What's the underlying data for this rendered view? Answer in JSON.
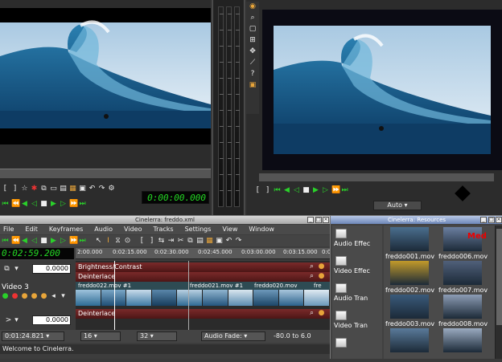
{
  "viewer": {
    "timecode": "0:00:00.000",
    "tool_icons": [
      "bracket-in-icon",
      "bracket-out-icon",
      "label-icon",
      "label-red-icon",
      "copy-icon",
      "splice-icon",
      "overwrite-icon",
      "clip-icon",
      "to-clip-icon",
      "undo-icon",
      "redo-icon",
      "settings-icon"
    ],
    "transport_icons": [
      "rewind-start-icon",
      "fast-reverse-icon",
      "frame-back-icon",
      "reverse-play-icon",
      "stop-icon",
      "play-icon",
      "frame-forward-icon",
      "fast-forward-icon",
      "jump-end-icon"
    ]
  },
  "compositor": {
    "zoom": "Auto",
    "tool_icons": [
      "protect-icon",
      "magnify-icon",
      "camera-icon",
      "projector-icon",
      "mask-icon",
      "eyedropper-icon",
      "help-icon",
      "safe-region-icon"
    ],
    "control_icons": [
      "prev-label-icon",
      "next-label-icon",
      "rewind-start-icon",
      "frame-back-icon",
      "reverse-play-icon",
      "stop-icon",
      "play-icon",
      "frame-forward-icon",
      "fast-forward-icon",
      "jump-end-icon"
    ]
  },
  "program": {
    "title": "Cinelerra: freddo.xml",
    "menu": [
      "File",
      "Edit",
      "Keyframes",
      "Audio",
      "Video",
      "Tracks",
      "Settings",
      "View",
      "Window"
    ],
    "timecode": "0:02:59.200",
    "ruler_labels": [
      "2:00.000",
      "0:02:15.000",
      "0:02:30.000",
      "0:02:45.000",
      "0:03:00.000",
      "0:03:15.000",
      "0:03:30.000"
    ],
    "track_name": "Video 3",
    "value_top": "0.0000",
    "value_bottom": "0.0000",
    "effects": [
      {
        "label": "Brightness/Contrast"
      },
      {
        "label": "Deinterlace"
      }
    ],
    "clip_labels": [
      "freddo022.mov #1",
      "freddo021.mov #1",
      "freddo020.mov",
      "fre"
    ],
    "effect_bottom": "Deinterlace",
    "position": "0:01:24.821",
    "sample_a": "16",
    "sample_b": "32",
    "audio_fade": "Audio Fade:",
    "range": "-80.0 to 6.0",
    "status": "Welcome to Cinelerra."
  },
  "resources": {
    "title": "Cinelerra: Resources",
    "folders": [
      {
        "label": "Audio Effec"
      },
      {
        "label": "Video Effec"
      },
      {
        "label": "Audio Tran"
      },
      {
        "label": "Video Tran"
      }
    ],
    "assets": [
      {
        "label": "freddo001.mov",
        "color": "#4a6e8e"
      },
      {
        "label": "freddo006.mov",
        "color": "#6b7fa0",
        "badge": "Med"
      },
      {
        "label": "freddo002.mov",
        "color": "#c29a2a"
      },
      {
        "label": "freddo007.mov",
        "color": "#50607a"
      },
      {
        "label": "freddo003.mov",
        "color": "#3a5a7a"
      },
      {
        "label": "freddo008.mov",
        "color": "#8c9cb4"
      },
      {
        "label": "",
        "color": "#5a7a9a"
      },
      {
        "label": "",
        "color": "#9aaac0"
      }
    ]
  },
  "colors": {
    "timecode_green": "#24d824",
    "transport_green": "#2ad12a",
    "effect_red": "#6e2222",
    "clip_teal": "#2e4b53"
  }
}
